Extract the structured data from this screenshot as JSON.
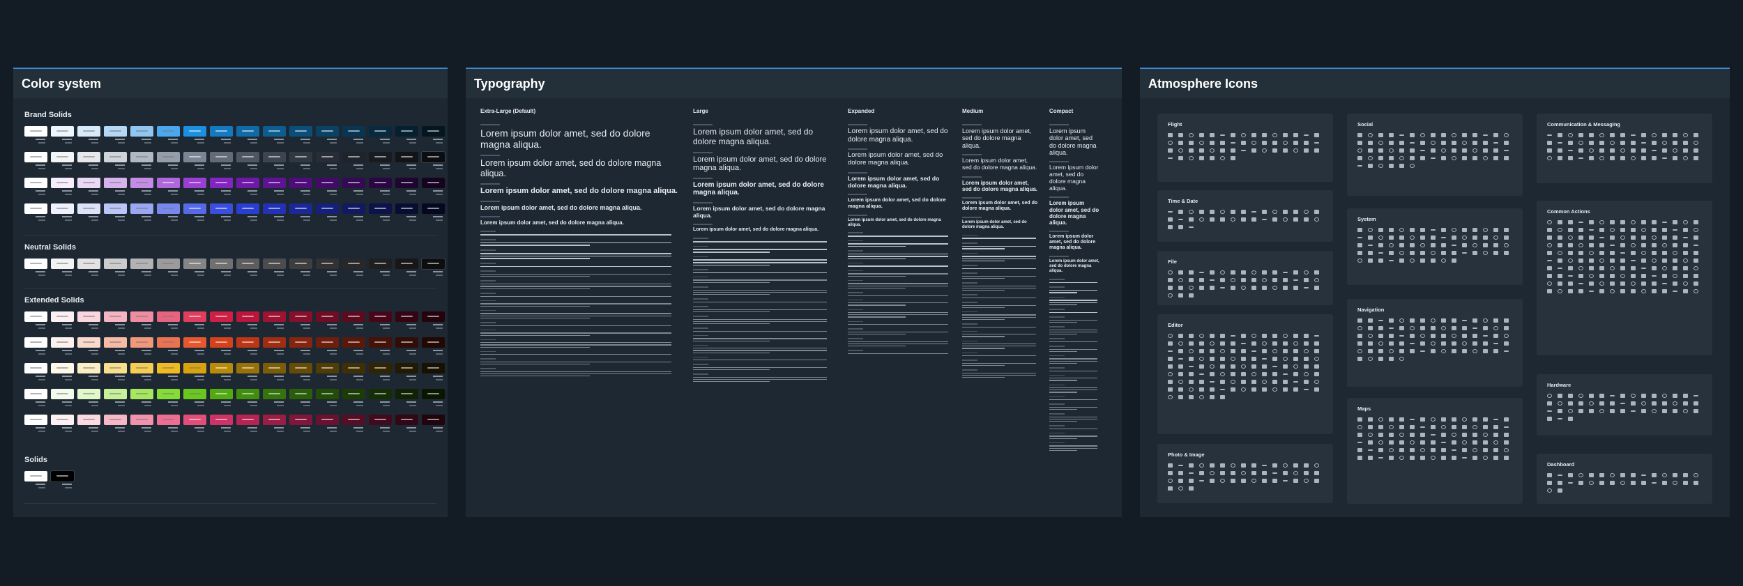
{
  "color_system": {
    "title": "Color system",
    "sections": {
      "brand": "Brand Solids",
      "neutral": "Neutral Solids",
      "extended": "Extended Solids",
      "solids": "Solids"
    },
    "brand_rows": [
      [
        "#ffffff",
        "#eef6fd",
        "#d8ebfb",
        "#b4d8f6",
        "#8fc6f2",
        "#4aa9ee",
        "#1d8fe0",
        "#137ac2",
        "#0f6aa7",
        "#0c5d90",
        "#0a4f7a",
        "#0a4266",
        "#083652",
        "#072a3f",
        "#05202f",
        "#041720"
      ],
      [
        "#ffffff",
        "#f4f5f7",
        "#e6e8ec",
        "#cfd3da",
        "#b2b8c3",
        "#959daa",
        "#7b8493",
        "#636b79",
        "#4f5663",
        "#3f4550",
        "#323842",
        "#282d35",
        "#1f232a",
        "#181b20",
        "#121418",
        "#0b0d10"
      ],
      [
        "#ffffff",
        "#f6effb",
        "#ead8f6",
        "#d7b3ee",
        "#c48ce5",
        "#b067dc",
        "#9a3fd2",
        "#8325c0",
        "#7018a8",
        "#5f1292",
        "#4f0d7c",
        "#420b68",
        "#360954",
        "#2a0742",
        "#1f0531",
        "#150320"
      ],
      [
        "#ffffff",
        "#eff1fd",
        "#dde2fb",
        "#bcc5f7",
        "#9aa7f3",
        "#7788ee",
        "#5669e8",
        "#3a4fe0",
        "#2a3fd2",
        "#2232b6",
        "#1b2898",
        "#15207c",
        "#111962",
        "#0c134a",
        "#080d34",
        "#050820"
      ]
    ],
    "neutral_row": [
      "#ffffff",
      "#f3f3f3",
      "#e2e2e2",
      "#cccccc",
      "#b3b3b3",
      "#9b9b9b",
      "#858585",
      "#707070",
      "#5d5d5d",
      "#4c4c4c",
      "#3e3e3e",
      "#323232",
      "#282828",
      "#1f1f1f",
      "#171717",
      "#0e0e0e"
    ],
    "extended_rows": [
      [
        "#ffffff",
        "#fdeff2",
        "#fad6de",
        "#f6b4c2",
        "#f08ca1",
        "#e9637f",
        "#e03e5f",
        "#cf1f44",
        "#b8163a",
        "#9e1232",
        "#860f2b",
        "#700c24",
        "#5c0a1e",
        "#480718",
        "#360512",
        "#24030c"
      ],
      [
        "#ffffff",
        "#fdf1ed",
        "#fadacd",
        "#f6bba4",
        "#f1977a",
        "#ec7350",
        "#e65730",
        "#d4421d",
        "#bb3616",
        "#9f2d12",
        "#85250f",
        "#6d1e0c",
        "#58180a",
        "#441207",
        "#320d05",
        "#210803"
      ],
      [
        "#ffffff",
        "#fdf8e7",
        "#fbeec2",
        "#f8df8c",
        "#f4cd52",
        "#efbb20",
        "#d9a30d",
        "#b88a0a",
        "#987208",
        "#7c5d07",
        "#644b06",
        "#503c05",
        "#3f2f04",
        "#302403",
        "#231a02",
        "#171101"
      ],
      [
        "#ffffff",
        "#f3fcea",
        "#e1f8c9",
        "#c6f198",
        "#a5e860",
        "#84dd34",
        "#69c81c",
        "#52aa12",
        "#418d0e",
        "#35740c",
        "#2b5e0a",
        "#234c08",
        "#1c3c07",
        "#152e05",
        "#102204",
        "#0a1602"
      ],
      [
        "#ffffff",
        "#fdf0f3",
        "#fad9e1",
        "#f6b7c7",
        "#f192ac",
        "#ec6e92",
        "#e24d79",
        "#cf3264",
        "#b52453",
        "#9a1d46",
        "#80173a",
        "#69122f",
        "#550e26",
        "#420b1d",
        "#310815",
        "#20050e"
      ]
    ],
    "solids_row": [
      "#ffffff",
      "#000000"
    ]
  },
  "typography": {
    "title": "Typography",
    "columns": [
      {
        "title": "Extra-Large (Default)"
      },
      {
        "title": "Large"
      },
      {
        "title": "Expanded"
      },
      {
        "title": "Medium"
      },
      {
        "title": "Compact"
      }
    ],
    "sample_display": "Lorem ipsum dolor amet, sed do dolore magna aliqua.",
    "sample_body": "Lorem ipsum dolor amet, sed do dolore magna aliqua.",
    "sample_para": "Lorem ipsum dolor sit amet, consectetur adipiscing elit, sed do eiusmod tempor incididunt ut labore et dolore magna aliqua, mauris sit amet massa vitae tortor condimentum lacinia."
  },
  "icons": {
    "title": "Atmosphere Icons",
    "categories": {
      "flight": "Flight",
      "time_date": "Time & Date",
      "file": "File",
      "editor": "Editor",
      "photo_image": "Photo & Image",
      "social": "Social",
      "system": "System",
      "navigation": "Navigation",
      "maps": "Maps",
      "comm": "Communication & Messaging",
      "common": "Common Actions",
      "hardware": "Hardware",
      "dashboard": "Dashboard"
    }
  }
}
